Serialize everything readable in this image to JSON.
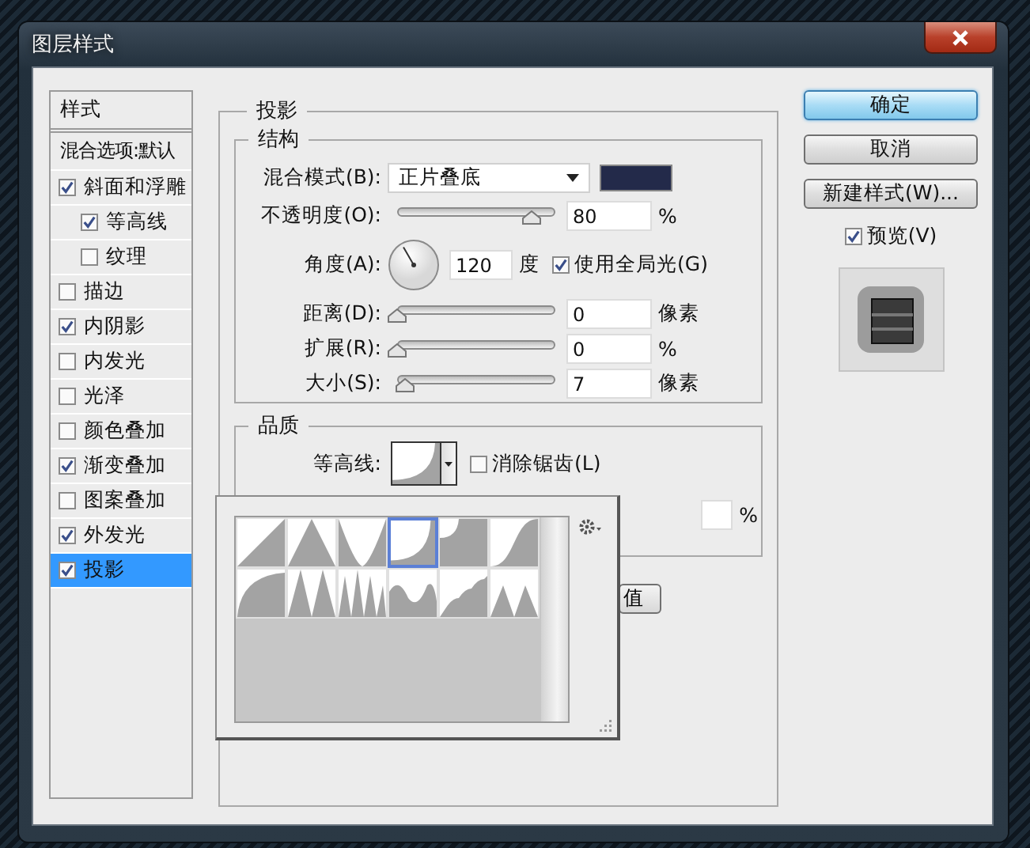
{
  "window": {
    "title": "图层样式"
  },
  "styles_list": {
    "header": "样式",
    "blending_options": "混合选项:默认",
    "items": [
      {
        "label": "斜面和浮雕",
        "checked": true,
        "selected": false,
        "children": [
          {
            "label": "等高线",
            "checked": true,
            "selected": false
          },
          {
            "label": "纹理",
            "checked": false,
            "selected": false
          }
        ]
      },
      {
        "label": "描边",
        "checked": false,
        "selected": false
      },
      {
        "label": "内阴影",
        "checked": true,
        "selected": false
      },
      {
        "label": "内发光",
        "checked": false,
        "selected": false
      },
      {
        "label": "光泽",
        "checked": false,
        "selected": false
      },
      {
        "label": "颜色叠加",
        "checked": false,
        "selected": false
      },
      {
        "label": "渐变叠加",
        "checked": true,
        "selected": false
      },
      {
        "label": "图案叠加",
        "checked": false,
        "selected": false
      },
      {
        "label": "外发光",
        "checked": true,
        "selected": false
      },
      {
        "label": "投影",
        "checked": true,
        "selected": true
      }
    ]
  },
  "panel": {
    "title": "投影",
    "structure": {
      "title": "结构",
      "blend_mode": {
        "label": "混合模式(B):",
        "value": "正片叠底",
        "color": "#232a4a"
      },
      "rows": [
        {
          "kind": "slider",
          "label": "不透明度(O):",
          "level": 0.8,
          "value": "80",
          "unit": "%"
        },
        {
          "kind": "angle",
          "label": "角度(A):",
          "value": "120",
          "unit": "度",
          "global_light": {
            "label": "使用全局光(G)",
            "checked": true
          }
        },
        {
          "kind": "slider",
          "label": "距离(D):",
          "level": 0,
          "value": "0",
          "unit": "像素"
        },
        {
          "kind": "slider",
          "label": "扩展(R):",
          "level": 0,
          "value": "0",
          "unit": "%"
        },
        {
          "kind": "slider",
          "label": "大小(S):",
          "level": 0.05,
          "value": "7",
          "unit": "像素"
        }
      ]
    },
    "quality": {
      "title": "品质",
      "contour": {
        "label": "等高线:"
      },
      "anti_aliased": {
        "label": "消除锯齿(L)",
        "checked": false
      },
      "noise_unit": "%"
    },
    "reset_button": "值"
  },
  "contour_picker": {
    "presets": [
      {
        "kind": "linear",
        "selected": false
      },
      {
        "kind": "cone",
        "selected": false
      },
      {
        "kind": "cone-inverted",
        "selected": false
      },
      {
        "kind": "cove-deep",
        "selected": true
      },
      {
        "kind": "cove-shallow",
        "selected": false
      },
      {
        "kind": "gaussian",
        "selected": false
      },
      {
        "kind": "half-round",
        "selected": false
      },
      {
        "kind": "ring",
        "selected": false
      },
      {
        "kind": "ring-double",
        "selected": false
      },
      {
        "kind": "rolling-slope",
        "selected": false
      },
      {
        "kind": "rounded-steps",
        "selected": false
      },
      {
        "kind": "sawtooth",
        "selected": false
      }
    ]
  },
  "buttons": [
    {
      "label": "确定",
      "default": true
    },
    {
      "label": "取消",
      "default": false
    },
    {
      "label": "新建样式(W)...",
      "default": false
    }
  ],
  "preview": {
    "label": "预览(V)",
    "checked": true
  }
}
